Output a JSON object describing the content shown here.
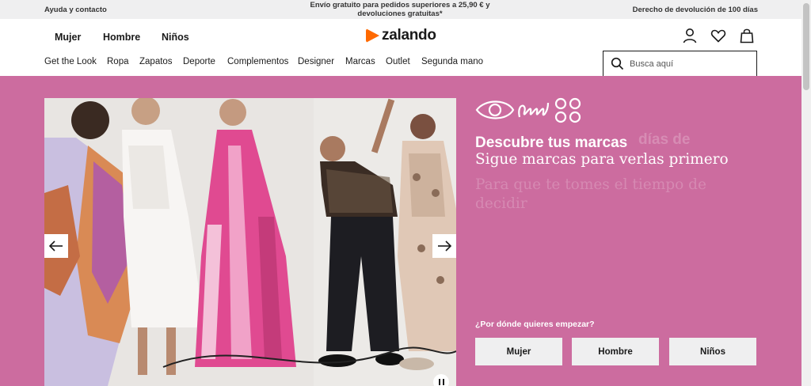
{
  "topbar": {
    "help": "Ayuda y contacto",
    "shipping": "Envío gratuito para pedidos superiores a 25,90 € y devoluciones gratuitas*",
    "returns": "Derecho de devolución de 100 días"
  },
  "header": {
    "genders": [
      "Mujer",
      "Hombre",
      "Niños"
    ],
    "logo": "zalando",
    "icons": [
      "user-icon",
      "heart-icon",
      "bag-icon"
    ],
    "categories": [
      "Get the Look",
      "Ropa",
      "Zapatos",
      "Deporte",
      "Complementos",
      "Designer",
      "Marcas",
      "Outlet",
      "Segunda mano"
    ],
    "search_placeholder": "Busca aquí"
  },
  "hero": {
    "background": "#cc6c9f",
    "title": "Descubre tus marcas",
    "title_ghost": "días de",
    "subtitle": "Sigue marcas para verlas primero",
    "ghost_text": "Para que te tomes el tiempo de decidir",
    "question": "¿Por dónde quieres empezar?",
    "choices": [
      "Mujer",
      "Hombre",
      "Niños"
    ]
  },
  "colors": {
    "accent": "#ff6900",
    "topbar": "#efeff0",
    "hero_bg": "#cc6c9f"
  }
}
